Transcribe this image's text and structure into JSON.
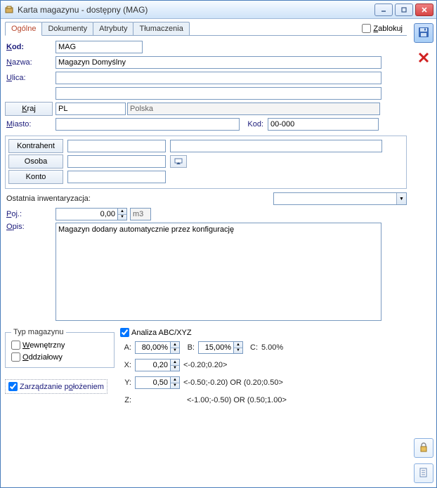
{
  "window": {
    "title": "Karta magazynu - dostępny (MAG)"
  },
  "tabs": {
    "ogolne": "Ogólne",
    "dokumenty": "Dokumenty",
    "atrybuty": "Atrybuty",
    "tlumaczenia": "Tłumaczenia"
  },
  "zablokuj_label": "Zablokuj",
  "form": {
    "kod_label": "Kod:",
    "kod_value": "MAG",
    "nazwa_label": "Nazwa:",
    "nazwa_value": "Magazyn Domyślny",
    "ulica_label": "Ulica:",
    "ulica_val1": "",
    "ulica_val2": "",
    "kraj_btn": "Kraj",
    "kraj_code": "PL",
    "kraj_name": "Polska",
    "miasto_label": "Miasto:",
    "miasto_value": "",
    "kod2_label": "Kod:",
    "kod2_value": "00-000",
    "kontrahent_btn": "Kontrahent",
    "kontrahent_v1": "",
    "kontrahent_v2": "",
    "osoba_btn": "Osoba",
    "osoba_val": "",
    "konto_btn": "Konto",
    "konto_val": "",
    "ostinw_label": "Ostatnia inwentaryzacja:",
    "ostinw_val": "",
    "poj_label": "Poj.:",
    "poj_value": "0,00",
    "poj_unit": "m3",
    "opis_label": "Opis:",
    "opis_value": "Magazyn dodany automatycznie przez konfigurację"
  },
  "typ_magazynu": {
    "legend": "Typ magazynu",
    "wewnetrzny": "Wewnętrzny",
    "oddzialowy": "Oddziałowy"
  },
  "zarzadzanie": "Zarządzanie położeniem",
  "abc": {
    "title": "Analiza ABC/XYZ",
    "a_label": "A:",
    "a_value": "80,00%",
    "b_label": "B:",
    "b_value": "15,00%",
    "c_label": "C:",
    "c_value": "5.00%",
    "x_label": "X:",
    "x_value": "0,20",
    "x_range": "<-0.20;0.20>",
    "y_label": "Y:",
    "y_value": "0,50",
    "y_range": "<-0.50;-0.20) OR (0.20;0.50>",
    "z_label": "Z:",
    "z_range": "<-1.00;-0.50) OR (0.50;1.00>"
  }
}
